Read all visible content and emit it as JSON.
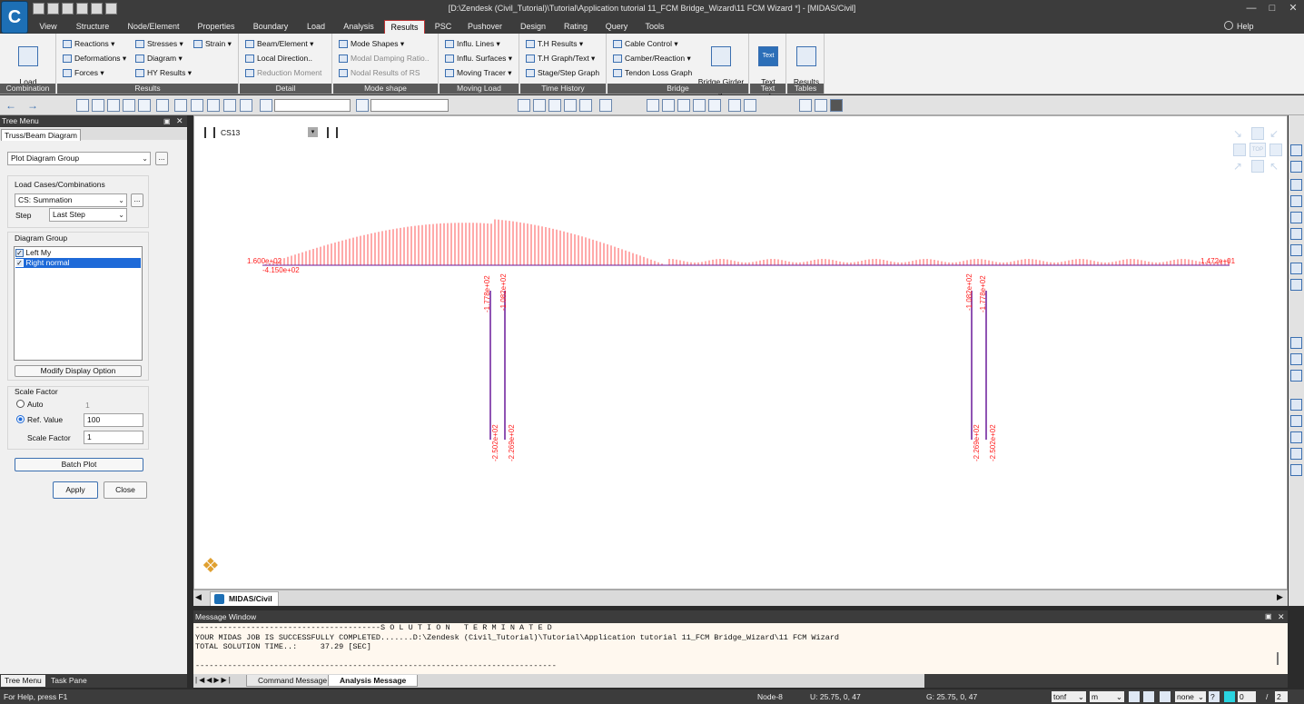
{
  "titlebar": {
    "title": "[D:\\Zendesk (Civil_Tutorial)\\Tutorial\\Application tutorial 11_FCM Bridge_Wizard\\11 FCM Wizard *] - [MIDAS/Civil]"
  },
  "menu_tabs": [
    "View",
    "Structure",
    "Node/Element",
    "Properties",
    "Boundary",
    "Load",
    "Analysis",
    "Results",
    "PSC",
    "Pushover",
    "Design",
    "Rating",
    "Query",
    "Tools"
  ],
  "help_label": "Help",
  "ribbon": {
    "combination": {
      "big": "Load\nCombination",
      "label": "Combination"
    },
    "results": {
      "label": "Results",
      "items": [
        "Reactions",
        "Deformations",
        "Forces",
        "Stresses",
        "Diagram",
        "HY Results",
        "Strain"
      ]
    },
    "detail": {
      "label": "Detail",
      "items": [
        "Beam/Element",
        "Local Direction..",
        "Reduction Moment"
      ]
    },
    "mode_shape": {
      "label": "Mode shape",
      "items": [
        "Mode Shapes",
        "Modal Damping Ratio..",
        "Nodal Results of RS"
      ]
    },
    "moving_load": {
      "label": "Moving Load",
      "items": [
        "Influ. Lines",
        "Influ. Surfaces",
        "Moving Tracer"
      ]
    },
    "time_history": {
      "label": "Time History",
      "items": [
        "T.H Results",
        "T.H Graph/Text",
        "Stage/Step Graph"
      ]
    },
    "bridge": {
      "label": "Bridge",
      "items": [
        "Cable Control",
        "Camber/Reaction",
        "Tendon Loss Graph"
      ],
      "big": "Bridge Girder\nDiagram"
    },
    "text": {
      "label": "Text",
      "big": "Text\nOutput",
      "icon_text": "Text"
    },
    "tables": {
      "label": "Tables",
      "big": "Results\nTables"
    }
  },
  "tree": {
    "header": "Tree Menu",
    "tab": "Truss/Beam Diagram",
    "plot_group": "Plot Diagram Group",
    "load_cases_label": "Load Cases/Combinations",
    "load_case": "CS: Summation",
    "step_label": "Step",
    "step": "Last Step",
    "diagram_group_label": "Diagram Group",
    "groups": [
      "Left My",
      "Right normal"
    ],
    "modify_btn": "Modify Display Option",
    "scale_label": "Scale Factor",
    "auto_label": "Auto",
    "auto_value": "1",
    "ref_label": "Ref. Value",
    "ref_value": "100",
    "scale_factor_label": "Scale Factor",
    "scale_factor_value": "1",
    "batch_btn": "Batch Plot",
    "apply_btn": "Apply",
    "close_btn": "Close",
    "bottom_tabs": [
      "Tree Menu",
      "Task Pane"
    ]
  },
  "canvas": {
    "stage": "CS13",
    "view_cube_label": "TOP",
    "doc_tab": "MIDAS/Civil",
    "left_end_labels": [
      "1.600e+02",
      "-4.150e+02"
    ],
    "right_end_label": "1.472e+01",
    "pier_labels": [
      "-1.778e+02",
      "-1.082e+02",
      "-2.502e+02",
      "-2.269e+02",
      "-1.082e+02",
      "-1.778e+02",
      "-2.269e+02",
      "-2.502e+02"
    ]
  },
  "messages": {
    "header": "Message Window",
    "lines": [
      "----------------------------------------S O L U T I O N   T E R M I N A T E D",
      "YOUR MIDAS JOB IS SUCCESSFULLY COMPLETED.......D:\\Zendesk (Civil_Tutorial)\\Tutorial\\Application tutorial 11_FCM Bridge_Wizard\\11 FCM Wizard",
      "TOTAL SOLUTION TIME..:     37.29 [SEC]",
      "------------------------------------------------------------------------------"
    ],
    "tabs": [
      "Command Message",
      "Analysis Message"
    ]
  },
  "status": {
    "help": "For Help, press F1",
    "node": "Node-8",
    "u": "U: 25.75, 0, 47",
    "g": "G: 25.75, 0, 47",
    "force_unit": "tonf",
    "length_unit": "m",
    "none_value": "none",
    "page": "0",
    "page_total": "2"
  }
}
